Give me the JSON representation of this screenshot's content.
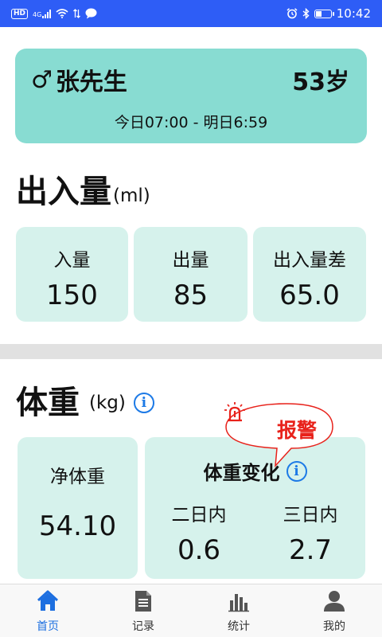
{
  "status_bar": {
    "network_badge": "HD",
    "signal_type": "4G",
    "time": "10:42",
    "icons": [
      "hd-icon",
      "signal-icon",
      "wifi-icon",
      "chat-icon",
      "alarm-icon",
      "bluetooth-icon",
      "battery-icon"
    ]
  },
  "patient": {
    "gender_symbol": "♂",
    "name": "张先生",
    "age": "53岁",
    "time_range": "今日07:00 - 明日6:59"
  },
  "intake_output": {
    "title": "出入量",
    "unit": "(ml)",
    "cards": [
      {
        "label": "入量",
        "value": "150"
      },
      {
        "label": "出量",
        "value": "85"
      },
      {
        "label": "出入量差",
        "value": "65.0"
      }
    ]
  },
  "weight": {
    "title": "体重",
    "unit": "(kg)",
    "info_icon": "i",
    "alarm_label": "报警",
    "net_weight": {
      "label": "净体重",
      "value": "54.10"
    },
    "change": {
      "title": "体重变化",
      "columns": [
        {
          "label": "二日内",
          "value": "0.6"
        },
        {
          "label": "三日内",
          "value": "2.7"
        }
      ]
    }
  },
  "bottom_nav": {
    "items": [
      {
        "label": "首页",
        "icon": "home-icon",
        "active": true
      },
      {
        "label": "记录",
        "icon": "document-icon",
        "active": false
      },
      {
        "label": "统计",
        "icon": "bar-chart-icon",
        "active": false
      },
      {
        "label": "我的",
        "icon": "user-icon",
        "active": false
      }
    ]
  },
  "colors": {
    "status_bar": "#2e5df6",
    "patient_card": "#88dcd2",
    "stat_card": "#d6f2ec",
    "alarm": "#e8221b",
    "accent": "#1d6fe0"
  }
}
